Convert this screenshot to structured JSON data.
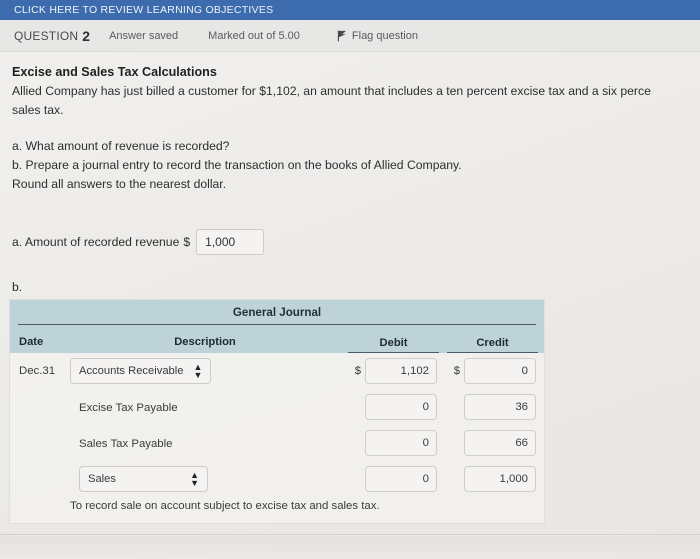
{
  "banner": {
    "link_text": "CLICK HERE TO REVIEW LEARNING OBJECTIVES",
    "background_color": "#3c6cad",
    "text_color": "#f0f3f8"
  },
  "question_bar": {
    "label": "QUESTION",
    "number": "2",
    "status": "Answer saved",
    "marks": "Marked out of 5.00",
    "flag_label": "Flag question",
    "flag_icon": "flag-icon",
    "background_color": "#e7e7e6"
  },
  "question": {
    "title": "Excise and Sales Tax Calculations",
    "body": "Allied Company has just billed a customer for $1,102, an amount that includes a ten percent excise tax and a six perce\nsales tax.",
    "parts": "a. What amount of revenue is recorded?\nb. Prepare a journal entry to record the transaction on the books of Allied Company.\nRound all answers to the nearest dollar.",
    "part_a_label": "a. Amount of recorded revenue",
    "part_a_dollar": "$",
    "part_a_value": "1,000",
    "part_a_placeholder": "",
    "part_b_label": "b."
  },
  "journal": {
    "title": "General Journal",
    "header_background": "#bed3d7",
    "columns": {
      "date": "Date",
      "description": "Description",
      "debit": "Debit",
      "credit": "Credit"
    },
    "rows": [
      {
        "date": "Dec.31",
        "description": "Accounts Receivable",
        "description_type": "select",
        "debit_dollar": "$",
        "debit": "1,102",
        "credit_dollar": "$",
        "credit": "0"
      },
      {
        "date": "",
        "description": "Excise Tax Payable",
        "description_type": "text",
        "debit_dollar": "",
        "debit": "0",
        "credit_dollar": "",
        "credit": "36"
      },
      {
        "date": "",
        "description": "Sales Tax Payable",
        "description_type": "text",
        "debit_dollar": "",
        "debit": "0",
        "credit_dollar": "",
        "credit": "66"
      },
      {
        "date": "",
        "description": "Sales",
        "description_type": "select",
        "debit_dollar": "",
        "debit": "0",
        "credit_dollar": "",
        "credit": "1,000"
      }
    ],
    "memo": "To record sale on account subject to excise tax and sales tax.",
    "select_arrows": "↕"
  }
}
